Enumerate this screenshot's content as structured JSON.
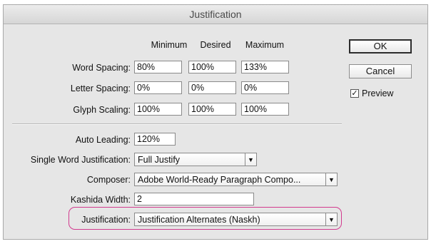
{
  "window": {
    "title": "Justification"
  },
  "columns": {
    "minimum": "Minimum",
    "desired": "Desired",
    "maximum": "Maximum"
  },
  "spacing": [
    {
      "label": "Word Spacing:",
      "minimum": "80%",
      "desired": "100%",
      "maximum": "133%"
    },
    {
      "label": "Letter Spacing:",
      "minimum": "0%",
      "desired": "0%",
      "maximum": "0%"
    },
    {
      "label": "Glyph Scaling:",
      "minimum": "100%",
      "desired": "100%",
      "maximum": "100%"
    }
  ],
  "auto_leading": {
    "label": "Auto Leading:",
    "value": "120%"
  },
  "single_word": {
    "label": "Single Word Justification:",
    "value": "Full Justify"
  },
  "composer": {
    "label": "Composer:",
    "value": "Adobe World-Ready Paragraph Compo..."
  },
  "kashida": {
    "label": "Kashida Width:",
    "value": "2"
  },
  "justification": {
    "label": "Justification:",
    "value": "Justification Alternates (Naskh)"
  },
  "buttons": {
    "ok": "OK",
    "cancel": "Cancel"
  },
  "preview": {
    "label": "Preview",
    "checked": true,
    "check_glyph": "✓"
  },
  "dropdown_glyph": "▼",
  "colors": {
    "highlight": "#d23a8e",
    "dialog_bg": "#e6e6e6"
  }
}
